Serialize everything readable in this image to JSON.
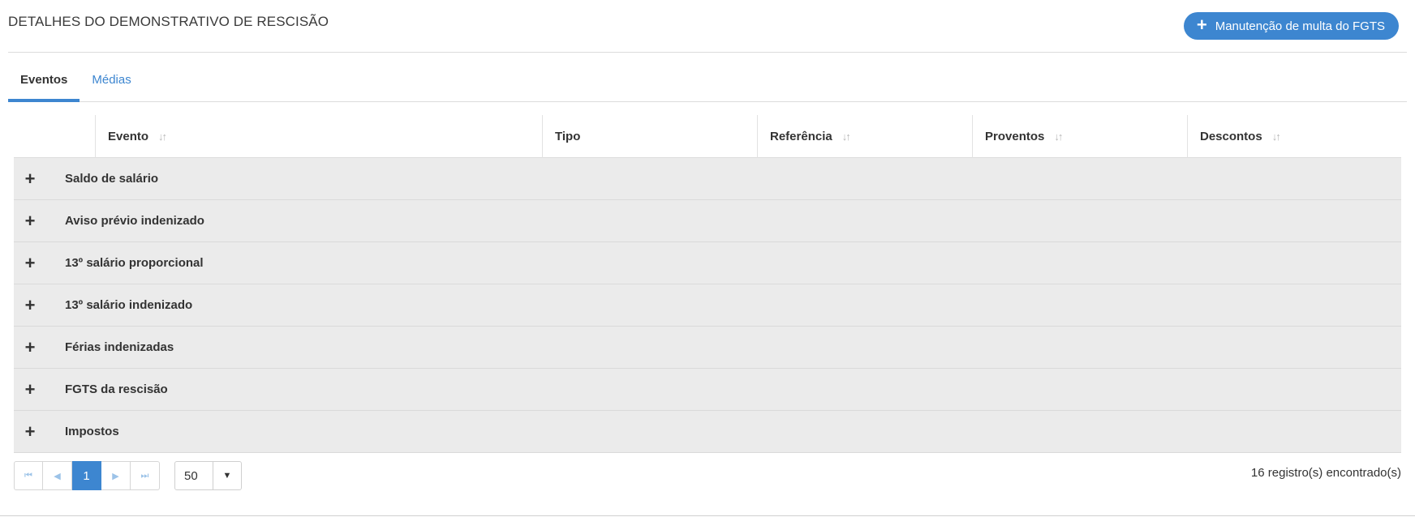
{
  "header": {
    "title": "DETALHES DO DEMONSTRATIVO DE RESCISÃO",
    "fgts_button": "Manutenção de multa do FGTS",
    "fgts_button_icon": "plus-icon"
  },
  "tabs": [
    {
      "label": "Eventos",
      "active": true
    },
    {
      "label": "Médias",
      "active": false
    }
  ],
  "grid": {
    "columns": [
      {
        "label": "Evento",
        "sortable": true
      },
      {
        "label": "Tipo",
        "sortable": false
      },
      {
        "label": "Referência",
        "sortable": true
      },
      {
        "label": "Proventos",
        "sortable": true
      },
      {
        "label": "Descontos",
        "sortable": true
      }
    ],
    "sort_icon": "↓↑",
    "expand_icon": "+",
    "groups": [
      "Saldo de salário",
      "Aviso prévio indenizado",
      "13º salário proporcional",
      "13º salário indenizado",
      "Férias indenizadas",
      "FGTS da rescisão",
      "Impostos"
    ]
  },
  "pagination": {
    "first_icon": "⏮",
    "prev_icon": "◀",
    "current_page": "1",
    "next_icon": "▶",
    "last_icon": "⏭",
    "page_size": "50",
    "page_size_caret": "▼",
    "records_text": "16 registro(s) encontrado(s)"
  },
  "colors": {
    "accent": "#3d86d0",
    "group_row_bg": "#ebebeb",
    "border": "#dcdcdc"
  }
}
